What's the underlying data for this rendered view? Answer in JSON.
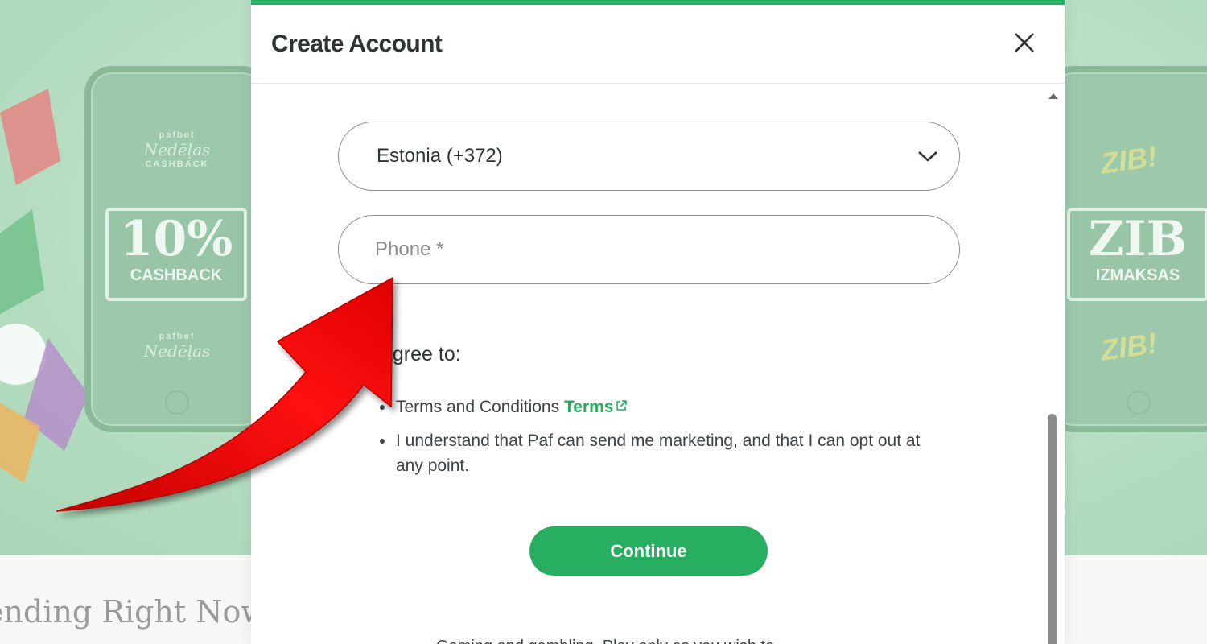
{
  "modal": {
    "title": "Create Account",
    "close_icon": "close-icon",
    "country_select": {
      "selected": "Estonia (+372)",
      "icon": "chevron-down-icon"
    },
    "phone": {
      "placeholder": "Phone *",
      "value": ""
    },
    "agree_heading": "agree to:",
    "agreements": {
      "terms_text": "Terms and Conditions",
      "terms_link": "Terms",
      "terms_link_icon": "external-link-icon",
      "marketing_text": "I understand that Paf can send me marketing, and that I can opt out at any point."
    },
    "continue_label": "Continue",
    "footer_text": "Gaming and gambling. Play only as you wish to"
  },
  "background": {
    "section_heading": "ending Right Now",
    "left_card": {
      "brand_top": "pafbet",
      "brand_script": "Nedēļas",
      "brand_caption": "CASHBACK",
      "badge_big": "10%",
      "badge_small": "CASHBACK",
      "brand_bottom": "pafbet",
      "brand_bottom_script": "Nedēļas"
    },
    "right_card": {
      "burst_top": "ZIB!",
      "badge_big": "ZIB",
      "badge_small": "IZMAKSAS",
      "burst_bottom": "ZIB!"
    }
  },
  "colors": {
    "accent": "#27ae60",
    "arrow": "#ff0000",
    "banner": "#bfe1c9"
  }
}
